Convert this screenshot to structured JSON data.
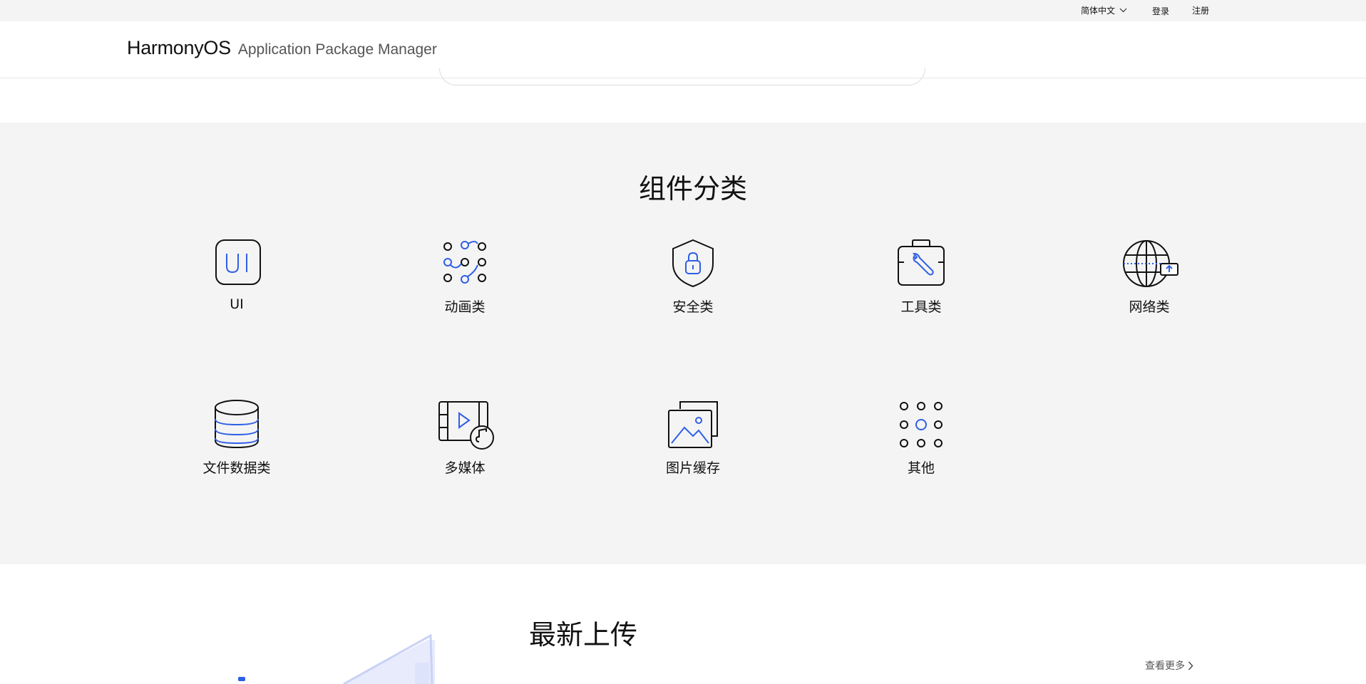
{
  "topbar": {
    "language": "简体中文",
    "login": "登录",
    "register": "注册"
  },
  "header": {
    "brand": "HarmonyOS",
    "product_name": "Application Package Manager"
  },
  "categories": {
    "title": "组件分类",
    "items": [
      {
        "label": "UI",
        "icon": "ui-icon"
      },
      {
        "label": "动画类",
        "icon": "animation-icon"
      },
      {
        "label": "安全类",
        "icon": "shield-lock-icon"
      },
      {
        "label": "工具类",
        "icon": "toolbox-icon"
      },
      {
        "label": "网络类",
        "icon": "globe-network-icon"
      },
      {
        "label": "文件数据类",
        "icon": "database-icon"
      },
      {
        "label": "多媒体",
        "icon": "multimedia-icon"
      },
      {
        "label": "图片缓存",
        "icon": "image-cache-icon"
      },
      {
        "label": "其他",
        "icon": "grid-dots-icon"
      }
    ]
  },
  "latest": {
    "title": "最新上传",
    "more_label": "查看更多"
  },
  "colors": {
    "accent": "#2f5fe6",
    "section_bg": "#f4f4f4",
    "text": "#111111"
  }
}
